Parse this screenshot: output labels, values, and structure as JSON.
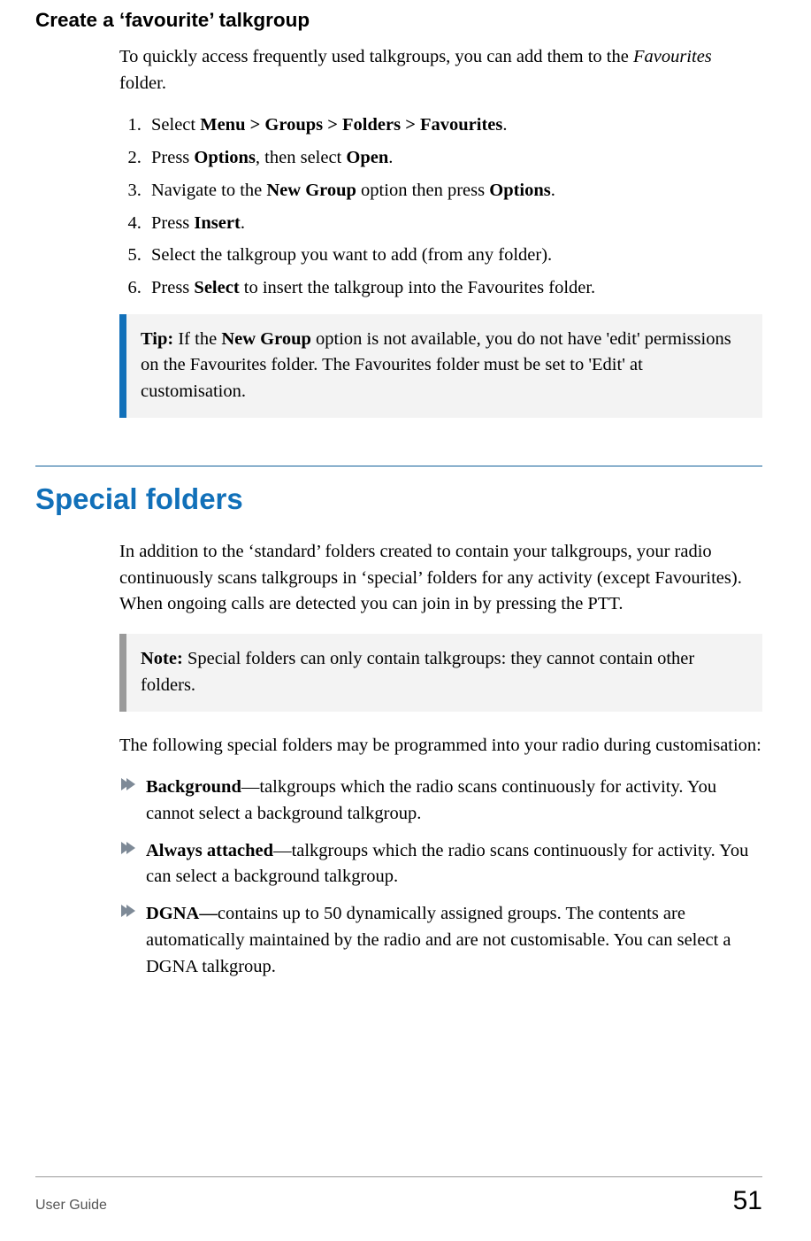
{
  "section1": {
    "heading": "Create a ‘favourite’ talkgroup",
    "intro_plain": "To quickly access frequently used talkgroups, you can add them to the Favourites folder.",
    "intro_html": "To quickly access frequently used talkgroups, you can add them to the <em>Favourites</em> folder.",
    "steps_plain": [
      "Select Menu > Groups > Folders > Favourites.",
      "Press Options, then select Open.",
      "Navigate to the New Group option then press Options.",
      "Press Insert.",
      "Select the talkgroup you want to add (from any folder).",
      "Press Select to insert the talkgroup into the Favourites folder."
    ],
    "steps_html": [
      "Select <b>Menu &gt; Groups &gt; Folders &gt; Favourites</b>.",
      "Press <b>Options</b>, then select <b>Open</b>.",
      "Navigate to the <b>New Group</b> option then press <b>Options</b>.",
      "Press <b>Insert</b>.",
      "Select the talkgroup you want to add (from any folder).",
      "Press <b>Select</b> to insert the talkgroup into the Favourites folder."
    ],
    "tip_label": "Tip:",
    "tip_plain": "If the New Group option is not available, you do not have 'edit' permissions on the Favourites folder. The Favourites folder must be set to 'Edit' at customisation.",
    "tip_html": "If the <b>New Group</b> option is not available, you do not have 'edit' permissions on the Favourites folder. The Favourites folder must be set to 'Edit' at customisation."
  },
  "section2": {
    "heading": "Special folders",
    "intro": "In addition to the ‘standard’ folders created to contain your talkgroups, your radio continuously scans talkgroups in ‘special’ folders for any activity (except Favourites). When ongoing calls are detected you can join in by pressing the PTT.",
    "note_label": "Note:",
    "note_text": "Special folders can only contain talkgroups: they cannot contain other folders.",
    "lead": "The following special folders may be programmed into your radio during customisation:",
    "bullets_plain": [
      "Background—talkgroups which the radio scans continuously for activity. You cannot select a background talkgroup.",
      "Always attached—talkgroups which the radio scans continuously for activity. You can select a background talkgroup.",
      "DGNA—contains up to 50 dynamically assigned groups. The contents are automatically maintained by the radio and are not customisable. You can select a DGNA talkgroup."
    ],
    "bullets_html": [
      "<b>Background</b>—talkgroups which the radio scans continuously for activity. You cannot select a background talkgroup.",
      "<b>Always attached</b>—talkgroups which the radio scans continuously for activity. You can select a background talkgroup.",
      "<b>DGNA—</b>contains up to 50 dynamically assigned groups. The contents are automatically maintained by the radio and are not customisable. You can select a DGNA talkgroup."
    ],
    "icon_name": "arrow-bullet-icon",
    "marker_color": "#7e8a97"
  },
  "footer": {
    "left": "User Guide",
    "right": "51"
  }
}
